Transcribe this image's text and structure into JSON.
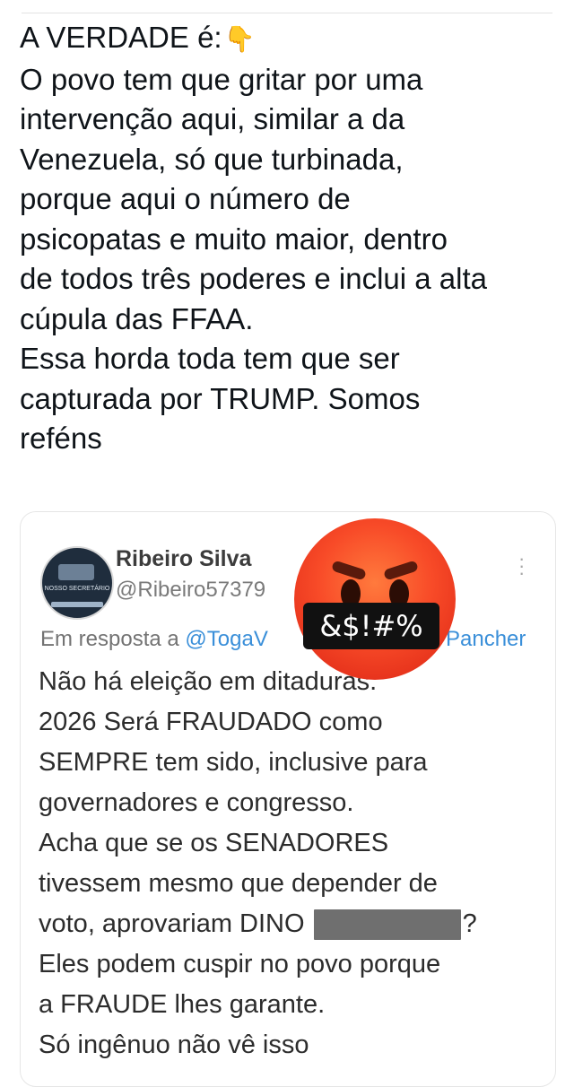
{
  "post": {
    "lines": [
      "A VERDADE é:",
      "O povo tem que gritar por uma",
      "intervenção aqui, similar a da",
      "Venezuela, só que turbinada,",
      "porque aqui o número de",
      "psicopatas e muito maior, dentro",
      "de todos três poderes e inclui a alta",
      "cúpula das FFAA.",
      "Essa horda toda tem que ser",
      "capturada por TRUMP. Somos",
      "reféns"
    ],
    "emoji_icon": "backhand-index-pointing-down",
    "emoji_glyph": "👇"
  },
  "quote": {
    "name": "Ribeiro Silva",
    "handle": "@Ribeiro57379",
    "reply_prefix": "Em resposta a",
    "reply_mention": "@TogaV",
    "reply_mention_tail": "Pancher",
    "body_lines": [
      "Não há eleição em ditaduras.",
      "2026 Será FRAUDADO como",
      "SEMPRE tem sido, inclusive para",
      "governadores e congresso.",
      "Acha que se os SENADORES",
      "tivessem mesmo que depender de",
      "voto, aprovariam DINO",
      "Eles podem cuspir no povo porque",
      "a FRAUDE lhes garante.",
      "Só ingênuo não vê isso"
    ],
    "body_line7_suffix": "?",
    "avatar_text": "NOSSO SECRETÁRIO",
    "more_icon": "more-vertical-icon"
  },
  "overlay": {
    "censor_text": "&$!#%",
    "emoji_icon": "face-with-symbols-on-mouth"
  },
  "colors": {
    "text": "#0f1419",
    "mention": "#3a8fd9",
    "muted": "#737373",
    "emoji_orange": "#f84b28"
  }
}
